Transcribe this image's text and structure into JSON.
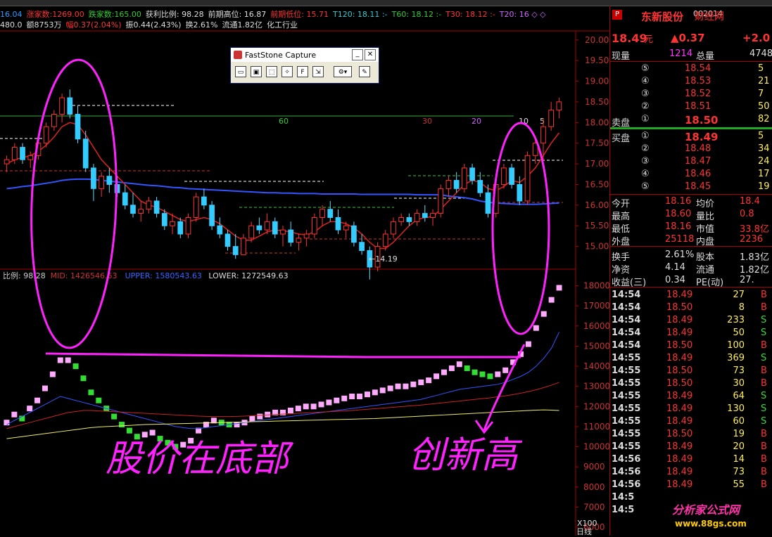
{
  "info_line1": [
    {
      "text": "16.04",
      "color": "#3399ff"
    },
    {
      "text": "涨家数:1269.00",
      "color": "#ff3333"
    },
    {
      "text": "跌家数:165.00",
      "color": "#33cc33"
    },
    {
      "text": "获利比例: 98.28",
      "color": "#dddddd"
    },
    {
      "text": "前期高位: 16.87",
      "color": "#dddddd"
    },
    {
      "text": "前期低位: 15.71",
      "color": "#ff3333"
    },
    {
      "text": "T120: 18.11 :-",
      "color": "#33cccc"
    },
    {
      "text": "T60: 18.12 :-",
      "color": "#33cc33"
    },
    {
      "text": "T30: 18.12 :-",
      "color": "#ff3333"
    },
    {
      "text": "T20: 16 ◇ ◇",
      "color": "#cc66ff"
    }
  ],
  "info_line2": [
    {
      "text": "480.0",
      "color": "#dddddd"
    },
    {
      "text": "额8753万",
      "color": "#dddddd"
    },
    {
      "text": "幅0.37(2.04%)",
      "color": "#ff3333"
    },
    {
      "text": "振0.44(2.43%)",
      "color": "#dddddd"
    },
    {
      "text": "换2.61%",
      "color": "#dddddd"
    },
    {
      "text": "流通1.82亿",
      "color": "#dddddd"
    },
    {
      "text": "化工行业",
      "color": "#dddddd"
    }
  ],
  "indicator_line": [
    {
      "text": "比例: 98.28",
      "color": "#cccccc"
    },
    {
      "text": "MID: 1426546.63",
      "color": "#cc3333"
    },
    {
      "text": "UPPER: 1580543.63",
      "color": "#3366ff"
    },
    {
      "text": "LOWER: 1272549.63",
      "color": "#dddddd"
    }
  ],
  "ma_labels": [
    {
      "text": "60",
      "color": "#33cc33"
    },
    {
      "text": "30",
      "color": "#cc3333"
    },
    {
      "text": "20",
      "color": "#cc66ff"
    },
    {
      "text": "10",
      "color": "#dddddd"
    },
    {
      "text": "5",
      "color": "#dddddd"
    }
  ],
  "min_price_label": "←14.19",
  "price_axis": [
    "20.00",
    "19.50",
    "19.00",
    "18.50",
    "18.00",
    "17.50",
    "17.00",
    "16.50",
    "16.00",
    "15.50",
    "15.00"
  ],
  "volume_axis": [
    "18000",
    "17000",
    "16000",
    "15000",
    "14000",
    "13000",
    "12000",
    "11000",
    "10000",
    "9000",
    "8000",
    "7000",
    "6000"
  ],
  "volume_scale": "X100",
  "annotations": {
    "bottom_text": "股价在底部",
    "breakout_text": "创新高"
  },
  "fs_window": {
    "title": "FastStone Capture",
    "close": "✕"
  },
  "right_panel": {
    "stock_name": "东新股份",
    "stock_code": "002014",
    "price": "18.49",
    "price_unit": "元",
    "change": "▲0.37",
    "change_pct": "+2.0",
    "now_vol_label": "现量",
    "now_vol": "1214",
    "total_vol_label": "总量",
    "total_vol": "4748",
    "sell_label": "卖盘",
    "buy_label": "买盘",
    "sells": [
      {
        "lvl": "⑤",
        "price": "18.54",
        "vol": "5"
      },
      {
        "lvl": "④",
        "price": "18.53",
        "vol": "21"
      },
      {
        "lvl": "③",
        "price": "18.52",
        "vol": "7"
      },
      {
        "lvl": "②",
        "price": "18.51",
        "vol": "50"
      },
      {
        "lvl": "①",
        "price": "18.50",
        "vol": "82"
      }
    ],
    "buys": [
      {
        "lvl": "①",
        "price": "18.49",
        "vol": "5"
      },
      {
        "lvl": "②",
        "price": "18.48",
        "vol": "34"
      },
      {
        "lvl": "③",
        "price": "18.47",
        "vol": "24"
      },
      {
        "lvl": "④",
        "price": "18.46",
        "vol": "17"
      },
      {
        "lvl": "⑤",
        "price": "18.45",
        "vol": "19"
      }
    ],
    "stats": [
      {
        "l1": "今开",
        "v1": "18.16",
        "l2": "均价",
        "v2": "18.4"
      },
      {
        "l1": "最高",
        "v1": "18.60",
        "l2": "量比",
        "v2": "0.8"
      },
      {
        "l1": "最低",
        "v1": "18.16",
        "l2": "市值",
        "v2": "33.8亿"
      },
      {
        "l1": "外盘",
        "v1": "25118",
        "l2": "内盘",
        "v2": "2236"
      },
      {
        "l1": "换手",
        "v1": "2.61%",
        "l2": "股本",
        "v2": "1.83亿"
      },
      {
        "l1": "净资",
        "v1": "4.14",
        "l2": "流通",
        "v2": "1.82亿"
      },
      {
        "l1": "收益(三)",
        "v1": "0.34",
        "l2": "PE(动)",
        "v2": "27."
      }
    ],
    "ticks": [
      {
        "t": "14:54",
        "p": "18.49",
        "v": "27",
        "d": "B"
      },
      {
        "t": "14:54",
        "p": "18.50",
        "v": "8",
        "d": "B"
      },
      {
        "t": "14:54",
        "p": "18.49",
        "v": "233",
        "d": "S"
      },
      {
        "t": "14:54",
        "p": "18.49",
        "v": "50",
        "d": "S"
      },
      {
        "t": "14:54",
        "p": "18.50",
        "v": "100",
        "d": "B"
      },
      {
        "t": "14:55",
        "p": "18.49",
        "v": "369",
        "d": "S"
      },
      {
        "t": "14:55",
        "p": "18.50",
        "v": "73",
        "d": "B"
      },
      {
        "t": "14:55",
        "p": "18.50",
        "v": "30",
        "d": "B"
      },
      {
        "t": "14:55",
        "p": "18.49",
        "v": "64",
        "d": "S"
      },
      {
        "t": "14:55",
        "p": "18.49",
        "v": "130",
        "d": "S"
      },
      {
        "t": "14:55",
        "p": "18.49",
        "v": "60",
        "d": "S"
      },
      {
        "t": "14:55",
        "p": "18.50",
        "v": "19",
        "d": "B"
      },
      {
        "t": "14:55",
        "p": "18.49",
        "v": "20",
        "d": "B"
      },
      {
        "t": "14:56",
        "p": "18.49",
        "v": "14",
        "d": "B"
      },
      {
        "t": "14:56",
        "p": "18.49",
        "v": "73",
        "d": "B"
      },
      {
        "t": "14:56",
        "p": "18.49",
        "v": "55",
        "d": "B"
      },
      {
        "t": "14:5",
        "p": "",
        "v": "",
        "d": ""
      },
      {
        "t": "14:5",
        "p": "",
        "v": "",
        "d": ""
      }
    ],
    "tab_label": "日线"
  },
  "watermark": {
    "title": "分析家公式网",
    "url": "www.88gs.com",
    "logo_text": "财经网"
  },
  "colors": {
    "up": "#ff3333",
    "down": "#00cc33",
    "magenta": "#ff22ff",
    "blue": "#3355ff",
    "yellow": "#ffee00",
    "pink": "#ffaaff"
  },
  "chart_data": {
    "type": "candlestick",
    "price_ylim": [
      14.5,
      20.2
    ],
    "volume_ylim": [
      6000,
      18300
    ],
    "candles": [
      [
        17.0,
        17.2,
        16.8,
        17.1
      ],
      [
        17.1,
        17.5,
        17.0,
        17.4
      ],
      [
        17.4,
        17.5,
        17.0,
        17.1
      ],
      [
        17.1,
        17.3,
        16.9,
        17.2
      ],
      [
        17.2,
        17.6,
        17.1,
        17.5
      ],
      [
        17.5,
        18.0,
        17.4,
        17.9
      ],
      [
        17.9,
        18.3,
        17.8,
        18.2
      ],
      [
        18.2,
        18.7,
        18.0,
        18.6
      ],
      [
        18.6,
        18.8,
        18.1,
        18.2
      ],
      [
        18.2,
        18.4,
        17.5,
        17.6
      ],
      [
        17.6,
        17.8,
        16.8,
        16.9
      ],
      [
        16.9,
        17.0,
        16.1,
        16.4
      ],
      [
        16.4,
        16.8,
        16.2,
        16.7
      ],
      [
        16.7,
        16.9,
        16.3,
        16.5
      ],
      [
        16.5,
        16.7,
        16.2,
        16.3
      ],
      [
        16.3,
        16.5,
        15.9,
        16.0
      ],
      [
        16.0,
        16.3,
        15.7,
        15.8
      ],
      [
        15.8,
        16.1,
        15.6,
        15.9
      ],
      [
        15.9,
        16.2,
        15.8,
        16.1
      ],
      [
        16.1,
        16.2,
        15.7,
        15.8
      ],
      [
        15.8,
        15.9,
        15.4,
        15.5
      ],
      [
        15.5,
        15.8,
        15.3,
        15.6
      ],
      [
        15.6,
        15.7,
        15.2,
        15.3
      ],
      [
        15.3,
        15.8,
        15.2,
        15.7
      ],
      [
        15.7,
        16.3,
        15.6,
        16.2
      ],
      [
        16.2,
        16.4,
        15.9,
        16.0
      ],
      [
        16.0,
        16.1,
        15.4,
        15.5
      ],
      [
        15.5,
        15.7,
        15.2,
        15.3
      ],
      [
        15.3,
        15.4,
        14.9,
        15.0
      ],
      [
        15.0,
        15.3,
        14.7,
        14.8
      ],
      [
        14.8,
        15.3,
        14.8,
        15.2
      ],
      [
        15.2,
        15.6,
        15.1,
        15.5
      ],
      [
        15.5,
        15.7,
        15.3,
        15.4
      ],
      [
        15.4,
        15.8,
        15.3,
        15.6
      ],
      [
        15.6,
        15.7,
        15.2,
        15.3
      ],
      [
        15.3,
        15.5,
        15.0,
        15.4
      ],
      [
        15.4,
        15.6,
        15.0,
        15.1
      ],
      [
        15.1,
        15.3,
        14.9,
        15.2
      ],
      [
        15.2,
        15.4,
        15.0,
        15.3
      ],
      [
        15.3,
        15.8,
        15.2,
        15.7
      ],
      [
        15.7,
        16.0,
        15.5,
        15.9
      ],
      [
        15.9,
        16.1,
        15.6,
        15.7
      ],
      [
        15.7,
        15.9,
        15.3,
        15.4
      ],
      [
        15.4,
        15.6,
        15.2,
        15.5
      ],
      [
        15.5,
        15.6,
        15.0,
        15.1
      ],
      [
        15.1,
        15.3,
        14.8,
        14.9
      ],
      [
        14.9,
        15.0,
        14.2,
        14.5
      ],
      [
        14.5,
        15.1,
        14.4,
        15.0
      ],
      [
        15.0,
        15.4,
        14.9,
        15.3
      ],
      [
        15.3,
        15.7,
        15.2,
        15.6
      ],
      [
        15.6,
        15.8,
        15.5,
        15.7
      ],
      [
        15.7,
        15.8,
        15.5,
        15.6
      ],
      [
        15.6,
        15.9,
        15.5,
        15.8
      ],
      [
        15.8,
        16.0,
        15.6,
        15.7
      ],
      [
        15.7,
        15.9,
        15.5,
        15.8
      ],
      [
        15.8,
        16.5,
        15.7,
        16.4
      ],
      [
        16.4,
        16.7,
        16.2,
        16.6
      ],
      [
        16.6,
        16.8,
        16.3,
        16.4
      ],
      [
        16.4,
        17.0,
        16.3,
        16.9
      ],
      [
        16.9,
        17.0,
        16.5,
        16.6
      ],
      [
        16.6,
        16.8,
        16.2,
        16.3
      ],
      [
        16.3,
        16.5,
        15.7,
        15.8
      ],
      [
        15.8,
        16.6,
        15.7,
        16.5
      ],
      [
        16.5,
        17.0,
        16.4,
        16.9
      ],
      [
        16.9,
        17.0,
        16.4,
        16.5
      ],
      [
        16.5,
        16.7,
        16.0,
        16.1
      ],
      [
        16.1,
        17.3,
        16.0,
        17.2
      ],
      [
        17.2,
        17.6,
        17.0,
        17.5
      ],
      [
        17.5,
        18.1,
        17.0,
        17.9
      ],
      [
        17.9,
        18.5,
        17.8,
        18.3
      ],
      [
        18.3,
        18.6,
        18.1,
        18.5
      ]
    ],
    "ma_red": [
      17.0,
      17.1,
      17.15,
      17.2,
      17.3,
      17.45,
      17.65,
      17.9,
      18.0,
      17.95,
      17.7,
      17.4,
      17.1,
      16.9,
      16.7,
      16.5,
      16.3,
      16.1,
      16.0,
      15.95,
      15.85,
      15.75,
      15.65,
      15.6,
      15.65,
      15.7,
      15.65,
      15.55,
      15.4,
      15.25,
      15.15,
      15.15,
      15.25,
      15.35,
      15.4,
      15.38,
      15.35,
      15.3,
      15.28,
      15.35,
      15.5,
      15.6,
      15.6,
      15.55,
      15.45,
      15.3,
      15.1,
      14.95,
      14.95,
      15.1,
      15.3,
      15.5,
      15.65,
      15.7,
      15.72,
      15.9,
      16.1,
      16.3,
      16.5,
      16.6,
      16.55,
      16.4,
      16.35,
      16.45,
      16.6,
      16.55,
      16.7,
      16.9,
      17.2,
      17.5,
      17.75
    ],
    "ma_blue": [
      16.4,
      16.42,
      16.45,
      16.47,
      16.5,
      16.53,
      16.56,
      16.6,
      16.62,
      16.63,
      16.63,
      16.62,
      16.6,
      16.58,
      16.56,
      16.54,
      16.52,
      16.5,
      16.48,
      16.47,
      16.45,
      16.43,
      16.42,
      16.4,
      16.39,
      16.38,
      16.37,
      16.36,
      16.35,
      16.34,
      16.33,
      16.32,
      16.31,
      16.3,
      16.3,
      16.29,
      16.29,
      16.28,
      16.28,
      16.28,
      16.27,
      16.27,
      16.27,
      16.27,
      16.27,
      16.26,
      16.26,
      16.26,
      16.26,
      16.26,
      16.26,
      16.26,
      16.25,
      16.25,
      16.25,
      16.25,
      16.22,
      16.2,
      16.18,
      16.15,
      16.1,
      16.07,
      16.05,
      16.04,
      16.03,
      16.02,
      16.02,
      16.02,
      16.03,
      16.04,
      16.05
    ],
    "volume_bars": [
      11200,
      11600,
      11400,
      11900,
      12300,
      12900,
      13600,
      14300,
      14300,
      14000,
      13400,
      12700,
      12300,
      11900,
      11500,
      11100,
      10800,
      10500,
      10600,
      10700,
      10400,
      10200,
      10000,
      10100,
      10300,
      10800,
      11100,
      11300,
      11200,
      11100,
      11100,
      11200,
      11400,
      11500,
      11600,
      11700,
      11700,
      11800,
      11900,
      12000,
      12000,
      12100,
      12200,
      12300,
      12400,
      12500,
      12500,
      12600,
      12700,
      12800,
      12900,
      13000,
      13000,
      13100,
      13200,
      13300,
      13500,
      13700,
      13900,
      14100,
      13900,
      13700,
      13600,
      13500,
      13600,
      13800,
      14200,
      14600,
      15100,
      15900,
      16600,
      17300,
      17900
    ],
    "volume_lines": {
      "blue": [
        11100,
        11300,
        11500,
        11700,
        11900,
        12100,
        12300,
        12500,
        12400,
        12300,
        12200,
        12100,
        12000,
        11900,
        11800,
        11700,
        11600,
        11500,
        11400,
        11300,
        11200,
        11100,
        11000,
        10950,
        10900,
        10900,
        10950,
        11000,
        11050,
        11100,
        11150,
        11200,
        11250,
        11300,
        11350,
        11400,
        11450,
        11500,
        11550,
        11600,
        11650,
        11700,
        11750,
        11800,
        11850,
        11900,
        11950,
        12000,
        12050,
        12100,
        12150,
        12200,
        12250,
        12300,
        12350,
        12450,
        12550,
        12650,
        12750,
        12850,
        12900,
        12950,
        13000,
        13050,
        13100,
        13200,
        13350,
        13500,
        13700,
        14000,
        14400,
        14900,
        15700
      ],
      "red": [
        10900,
        11000,
        11100,
        11200,
        11300,
        11400,
        11500,
        11600,
        11700,
        11750,
        11800,
        11800,
        11780,
        11760,
        11740,
        11720,
        11700,
        11680,
        11660,
        11640,
        11620,
        11600,
        11580,
        11560,
        11540,
        11520,
        11510,
        11500,
        11500,
        11500,
        11510,
        11520,
        11540,
        11560,
        11580,
        11600,
        11620,
        11640,
        11660,
        11680,
        11700,
        11720,
        11740,
        11760,
        11780,
        11800,
        11830,
        11860,
        11890,
        11920,
        11950,
        11980,
        12010,
        12040,
        12070,
        12110,
        12150,
        12190,
        12230,
        12270,
        12310,
        12350,
        12390,
        12430,
        12480,
        12530,
        12590,
        12660,
        12740,
        12830,
        12940,
        13060,
        13200
      ],
      "yellow": [
        10400,
        10450,
        10500,
        10550,
        10600,
        10650,
        10700,
        10750,
        10800,
        10850,
        10900,
        10950,
        10980,
        11000,
        11020,
        11040,
        11060,
        11080,
        11100,
        11110,
        11120,
        11130,
        11140,
        11150,
        11160,
        11170,
        11180,
        11190,
        11200,
        11210,
        11220,
        11230,
        11240,
        11250,
        11260,
        11270,
        11280,
        11290,
        11300,
        11310,
        11320,
        11330,
        11340,
        11350,
        11360,
        11370,
        11380,
        11390,
        11400,
        11420,
        11440,
        11460,
        11480,
        11500,
        11520,
        11540,
        11560,
        11580,
        11600,
        11620,
        11640,
        11660,
        11680,
        11700,
        11720,
        11740,
        11760,
        11780,
        11800,
        11820,
        11830,
        11820,
        11800
      ]
    }
  }
}
